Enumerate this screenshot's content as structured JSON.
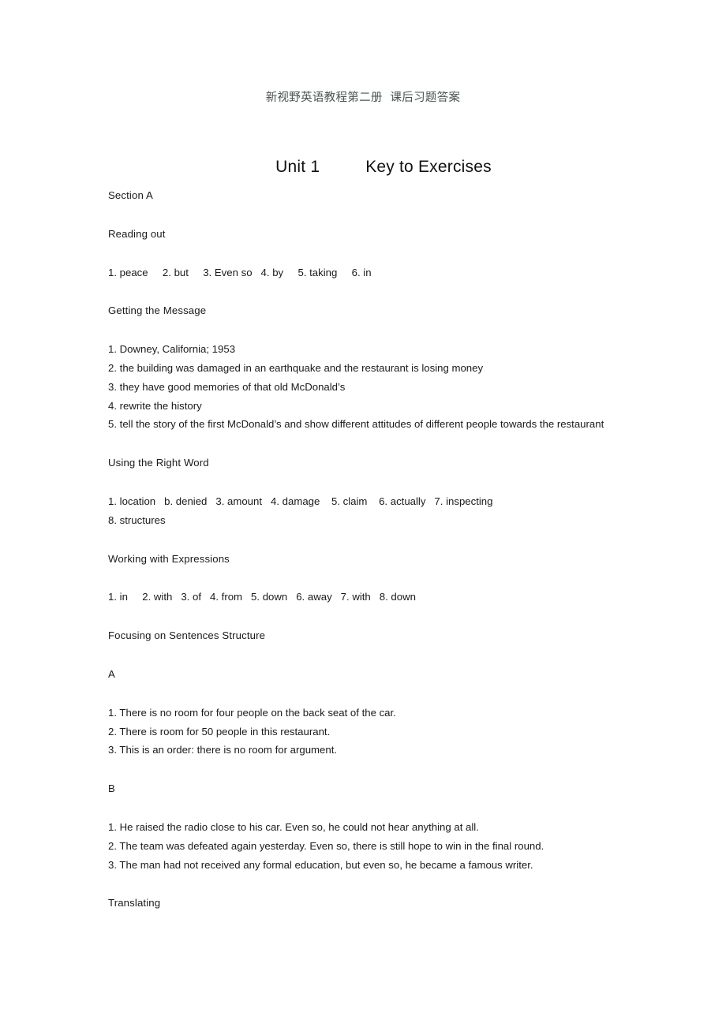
{
  "document": {
    "running_header": "新视野英语教程第二册  课后习题答案",
    "title_unit": "Unit 1",
    "title_key": "Key to Exercises",
    "section_a_label": "Section A",
    "headings": {
      "reading_out": "Reading out",
      "getting_the_message": "Getting the Message",
      "using_the_right_word": "Using the Right Word",
      "working_with_expressions": "Working with Expressions",
      "focusing_on_sentences_structure": "Focusing on Sentences Structure",
      "sub_a": "A",
      "sub_b": "B",
      "translating": "Translating"
    },
    "reading_out_answers": "1. peace     2. but     3. Even so   4. by     5. taking     6. in",
    "getting_the_message_answers": [
      "1. Downey, California; 1953",
      "2. the building was damaged in an earthquake and the restaurant is losing money",
      "3. they have good memories of that old McDonald’s",
      "4. rewrite the history",
      "5. tell the story of the first McDonald’s and show different attitudes of different people towards the restaurant"
    ],
    "using_the_right_word_answers": [
      "1. location   b. denied   3. amount   4. damage    5. claim    6. actually   7. inspecting",
      "8. structures"
    ],
    "working_with_expressions_answers": "1. in     2. with   3. of   4. from   5. down   6. away   7. with   8. down",
    "focusing_a_answers": [
      "1. There is no room for four people on the back seat of the car.",
      "2. There is room for 50 people in this restaurant.",
      "3. This is an order: there is no room for argument."
    ],
    "focusing_b_answers": [
      "1. He raised the radio close to his car. Even so, he could not hear anything at all.",
      "2. The team was defeated again yesterday. Even so, there is still hope to win in the final round.",
      "3. The man had not received any formal education, but even so, he became a famous writer."
    ]
  }
}
